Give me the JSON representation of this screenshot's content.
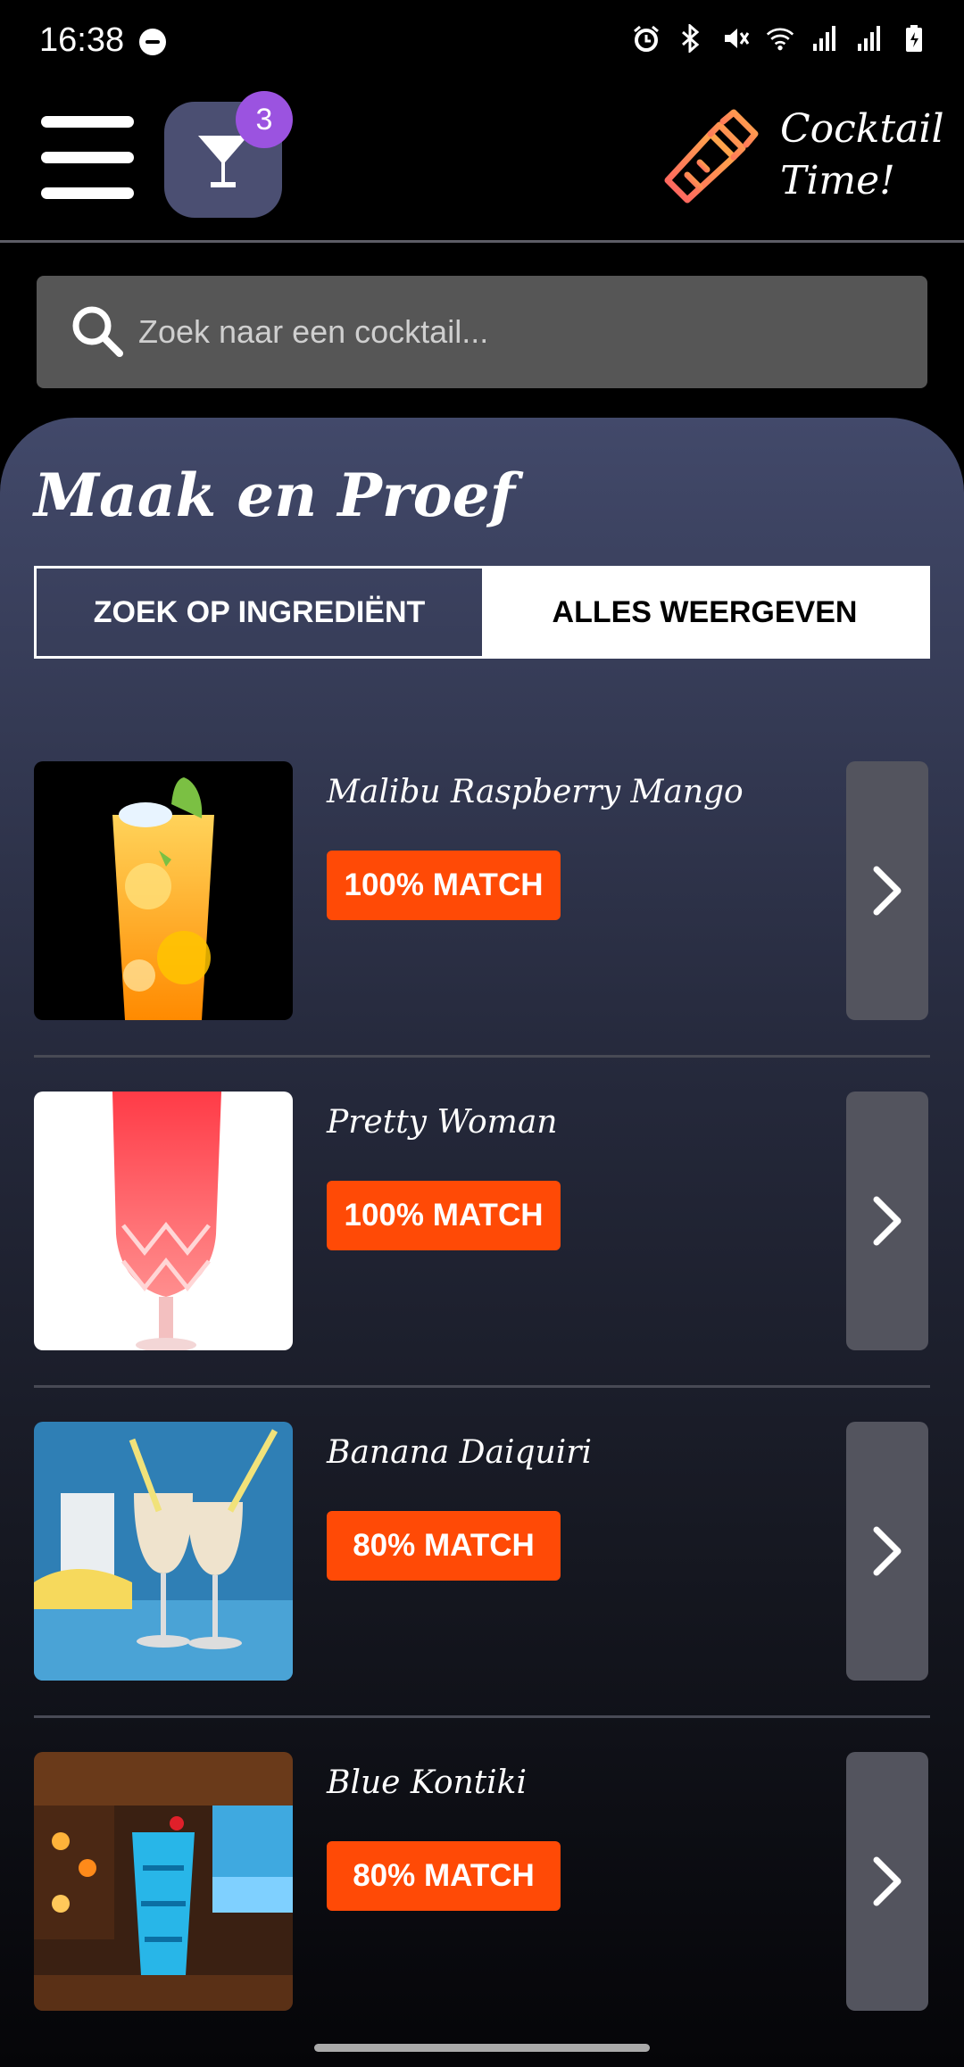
{
  "status_bar": {
    "time": "16:38",
    "icons": [
      "do-not-disturb-icon",
      "alarm-icon",
      "bluetooth-icon",
      "mute-icon",
      "wifi-icon",
      "signal-icon",
      "signal-icon",
      "battery-charging-icon"
    ]
  },
  "header": {
    "menu_icon": "hamburger-menu-icon",
    "cart_icon": "martini-glass-icon",
    "cart_count": "3",
    "logo_icon": "cocktail-shaker-icon",
    "brand_line1": "Cocktail",
    "brand_line2": "Time!"
  },
  "search": {
    "placeholder": "Zoek naar een cocktail...",
    "value": ""
  },
  "main": {
    "title": "Maak en Proef",
    "tabs": [
      {
        "label": "ZOEK OP INGREDIËNT",
        "active": false
      },
      {
        "label": "ALLES WEERGEVEN",
        "active": true
      }
    ],
    "cocktails": [
      {
        "name": "Malibu Raspberry Mango",
        "match": "100% MATCH"
      },
      {
        "name": "Pretty Woman",
        "match": "100% MATCH"
      },
      {
        "name": "Banana Daiquiri",
        "match": "80% MATCH"
      },
      {
        "name": "Blue Kontiki",
        "match": "80% MATCH"
      }
    ]
  },
  "colors": {
    "accent": "#ff4a06",
    "badge": "#9b53e0",
    "cart_button": "#4b4f72",
    "search_bg": "#565656",
    "logo_gradient": [
      "#ffb347",
      "#ff5e62"
    ]
  }
}
